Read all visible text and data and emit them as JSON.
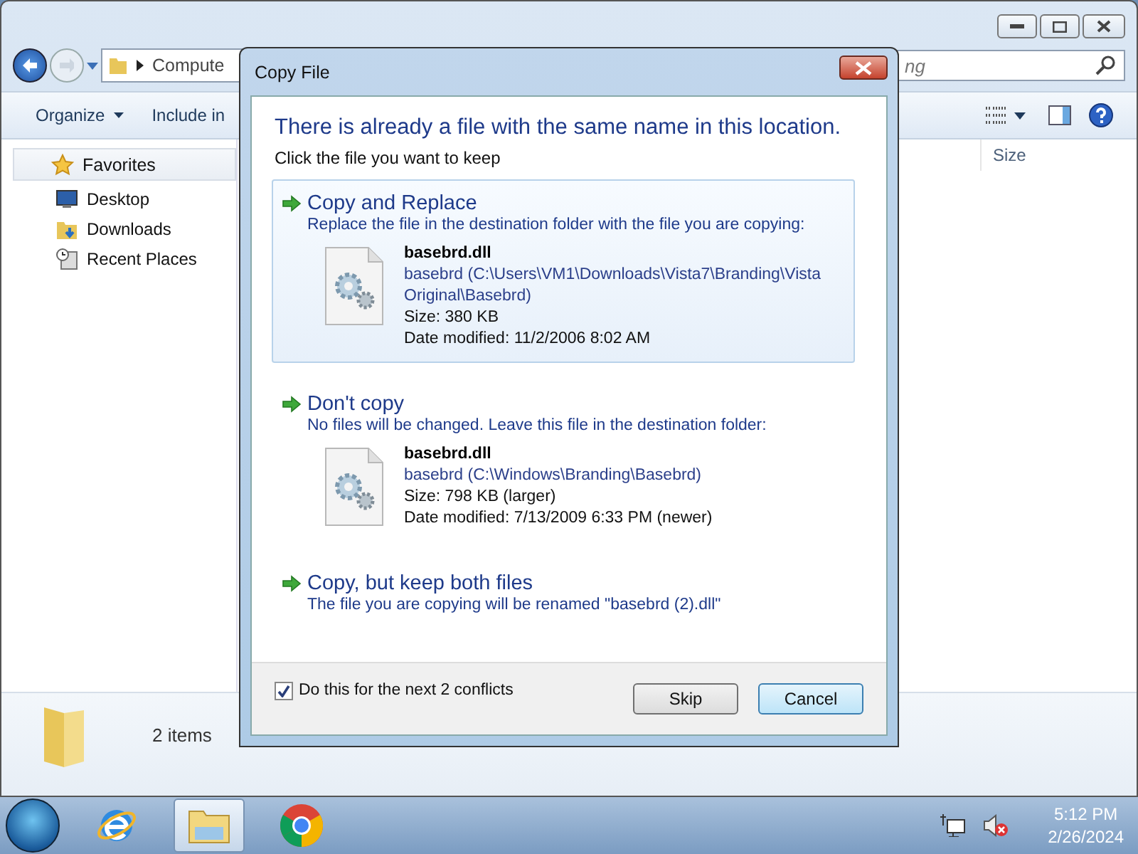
{
  "explorer": {
    "address": "Compute",
    "search": {
      "placeholder": "ng"
    },
    "toolbar": [
      "Organize",
      "Include in"
    ],
    "sidebar": {
      "items": [
        {
          "label": "Favorites",
          "kind": "favorites"
        },
        {
          "label": "Desktop",
          "kind": "desktop"
        },
        {
          "label": "Downloads",
          "kind": "downloads"
        },
        {
          "label": "Recent Places",
          "kind": "recent"
        }
      ]
    },
    "columns": [
      "Size"
    ],
    "status": "2 items"
  },
  "dialog": {
    "title": "Copy File",
    "heading": "There is already a file with the same name in this location.",
    "subheading": "Click the file you want to keep",
    "options": [
      {
        "title": "Copy and Replace",
        "description": "Replace the file in the destination folder with the file you are copying:",
        "selected": true,
        "file": {
          "name": "basebrd.dll",
          "path": "basebrd (C:\\Users\\VM1\\Downloads\\Vista7\\Branding\\Vista Original\\Basebrd)",
          "size": "Size: 380 KB",
          "date": "Date modified: 11/2/2006 8:02 AM"
        }
      },
      {
        "title": "Don't copy",
        "description": "No files will be changed. Leave this file in the destination folder:",
        "selected": false,
        "file": {
          "name": "basebrd.dll",
          "path": "basebrd (C:\\Windows\\Branding\\Basebrd)",
          "size": "Size: 798 KB (larger)",
          "date": "Date modified: 7/13/2009 6:33 PM (newer)"
        }
      },
      {
        "title": "Copy, but keep both files",
        "description": "The file you are copying will be renamed \"basebrd (2).dll\"",
        "selected": false
      }
    ],
    "checkbox": {
      "label": "Do this for the next 2 conflicts",
      "checked": true
    },
    "buttons": [
      {
        "label": "Skip",
        "default": false
      },
      {
        "label": "Cancel",
        "default": true
      }
    ]
  },
  "taskbar": {
    "apps": [
      {
        "kind": "ie",
        "selected": false
      },
      {
        "kind": "explorer",
        "selected": true
      },
      {
        "kind": "chrome",
        "selected": false
      }
    ],
    "time": "5:12 PM",
    "date": "2/26/2024"
  }
}
